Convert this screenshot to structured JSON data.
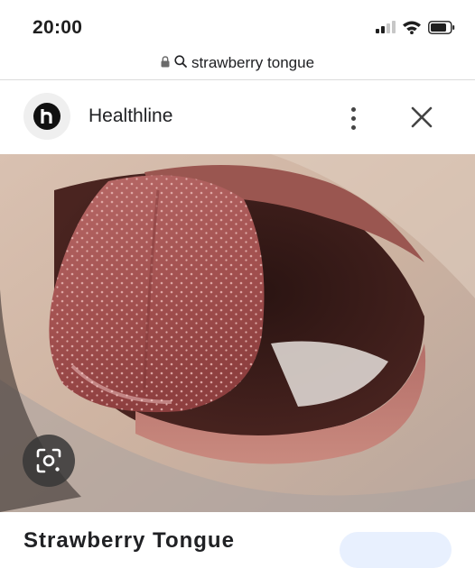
{
  "status": {
    "time": "20:00"
  },
  "url_bar": {
    "query": "strawberry tongue",
    "lock_icon": "lock-icon",
    "search_icon": "search-icon"
  },
  "source": {
    "name": "Healthline",
    "logo_letter": "h",
    "logo_color": "#111111"
  },
  "result": {
    "title": "Strawberry Tongue"
  },
  "icons": {
    "more": "more-vert-icon",
    "close": "close-icon",
    "lens": "lens-icon"
  },
  "colors": {
    "accent_pill": "#e8f0fe",
    "divider": "#dcdcdc"
  }
}
